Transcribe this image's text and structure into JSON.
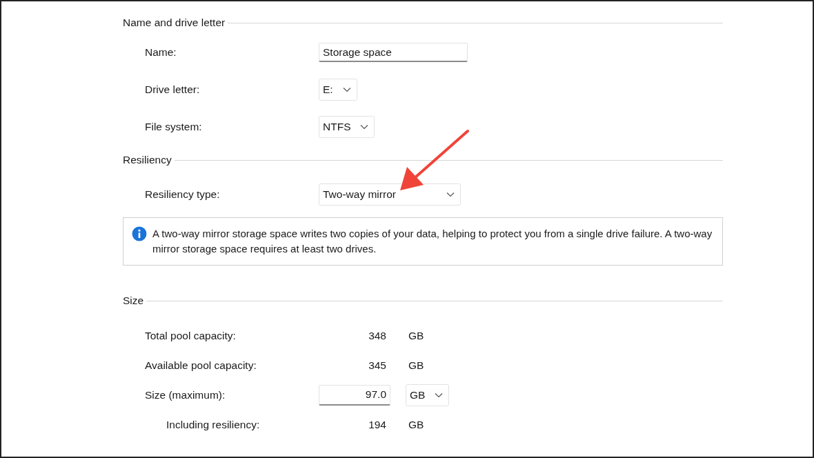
{
  "sections": [
    {
      "title": "Name and drive letter",
      "rows": [
        {
          "kind": "text",
          "label": "Name:",
          "value": "Storage space"
        },
        {
          "kind": "dropdown",
          "label": "Drive letter:",
          "value": "E:"
        },
        {
          "kind": "dropdown",
          "label": "File system:",
          "value": "NTFS"
        }
      ]
    },
    {
      "title": "Resiliency",
      "rows": [
        {
          "kind": "dropdown-wide",
          "label": "Resiliency type:",
          "value": "Two-way mirror"
        },
        {
          "kind": "info",
          "text": "A two-way mirror storage space writes two copies of your data, helping to protect you from a single drive failure. A two-way mirror storage space requires at least two drives."
        }
      ]
    },
    {
      "title": "Size",
      "rows": [
        {
          "kind": "reading",
          "label": "Total pool capacity:",
          "value": "348",
          "unit": "GB"
        },
        {
          "kind": "reading",
          "label": "Available pool capacity:",
          "value": "345",
          "unit": "GB"
        },
        {
          "kind": "size-input",
          "label": "Size (maximum):",
          "value": "97.0",
          "unit": "GB"
        },
        {
          "kind": "reading-indented",
          "label": "Including resiliency:",
          "value": "194",
          "unit": "GB"
        }
      ]
    }
  ]
}
